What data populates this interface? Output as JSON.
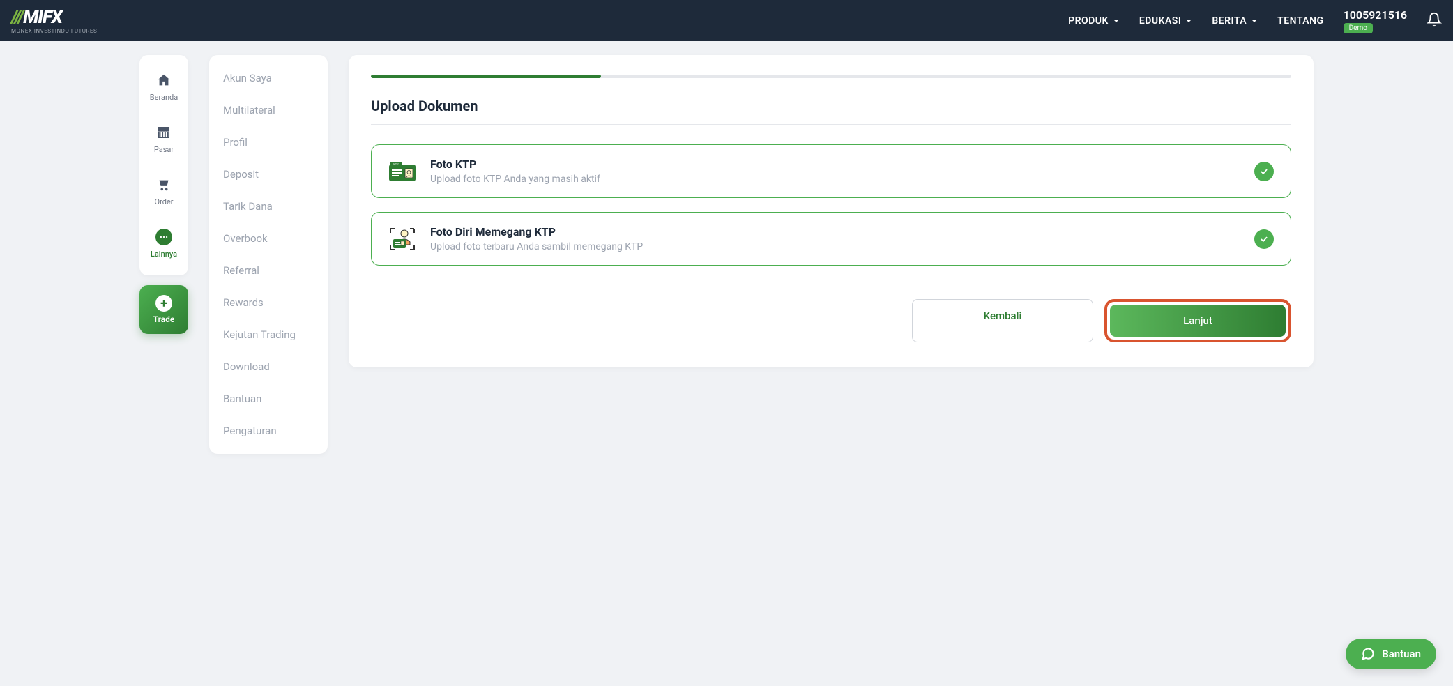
{
  "header": {
    "logo_sub": "MONEX INVESTINDO FUTURES",
    "nav": [
      {
        "label": "PRODUK",
        "dropdown": true
      },
      {
        "label": "EDUKASI",
        "dropdown": true
      },
      {
        "label": "BERITA",
        "dropdown": true
      },
      {
        "label": "TENTANG",
        "dropdown": false
      }
    ],
    "account_id": "1005921516",
    "account_badge": "Demo"
  },
  "sidebar1": {
    "items": [
      {
        "label": "Beranda",
        "icon": "home"
      },
      {
        "label": "Pasar",
        "icon": "market"
      },
      {
        "label": "Order",
        "icon": "cart"
      },
      {
        "label": "Lainnya",
        "icon": "dots",
        "active": true
      }
    ],
    "trade_label": "Trade"
  },
  "sidebar2": {
    "items": [
      "Akun Saya",
      "Multilateral",
      "Profil",
      "Deposit",
      "Tarik Dana",
      "Overbook",
      "Referral",
      "Rewards",
      "Kejutan Trading",
      "Download",
      "Bantuan",
      "Pengaturan"
    ]
  },
  "main": {
    "title": "Upload Dokumen",
    "uploads": [
      {
        "title": "Foto KTP",
        "desc": "Upload foto KTP Anda yang masih aktif",
        "done": true
      },
      {
        "title": "Foto Diri Memegang KTP",
        "desc": "Upload foto terbaru Anda sambil memegang KTP",
        "done": true
      }
    ],
    "back_label": "Kembali",
    "next_label": "Lanjut"
  },
  "help_fab": "Bantuan"
}
